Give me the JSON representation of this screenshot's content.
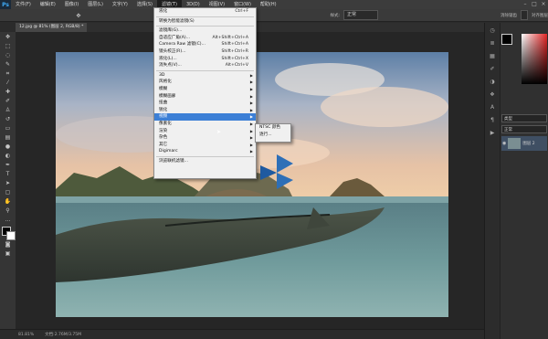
{
  "menubar": {
    "logo": "Ps",
    "items": [
      "文件(F)",
      "编辑(E)",
      "图像(I)",
      "图层(L)",
      "文字(Y)",
      "选择(S)",
      "滤镜(T)",
      "3D(D)",
      "视图(V)",
      "窗口(W)",
      "帮助(H)"
    ],
    "active_index": 6
  },
  "options": {
    "mode_label": "图层",
    "style_label": "样式:",
    "style_value": "正常",
    "smooth_label": "消除锯齿",
    "checkbox_label": "对齐图层"
  },
  "tab": {
    "title": "12.jpg @ 81% (图层 2, RGB/8) *"
  },
  "filter_menu": {
    "top": [
      {
        "label": "液化",
        "shortcut": "Ctrl+F"
      },
      {
        "label": "转换为智能滤镜(S)",
        "shortcut": ""
      }
    ],
    "mid": [
      {
        "label": "滤镜库(G)...",
        "shortcut": ""
      },
      {
        "label": "自适应广角(A)...",
        "shortcut": "Alt+Shift+Ctrl+A"
      },
      {
        "label": "Camera Raw 滤镜(C)...",
        "shortcut": "Shift+Ctrl+A"
      },
      {
        "label": "镜头校正(R)...",
        "shortcut": "Shift+Ctrl+R"
      },
      {
        "label": "液化(L)...",
        "shortcut": "Shift+Ctrl+X"
      },
      {
        "label": "消失点(V)...",
        "shortcut": "Alt+Ctrl+V"
      }
    ],
    "sub": [
      "3D",
      "风格化",
      "模糊",
      "模糊画廊",
      "扭曲",
      "锐化",
      "视频",
      "像素化",
      "渲染",
      "杂色",
      "其它"
    ],
    "plain": [
      "Digimarc"
    ],
    "browse": "浏览联机滤镜...",
    "highlight_label": "视频"
  },
  "video_submenu": [
    "NTSC 颜色",
    "逐行..."
  ],
  "statusbar": {
    "zoom": "81.81%",
    "doc": "文档:2.76M/3.75M"
  },
  "layers": {
    "layer_name": "图层 2",
    "kind_label": "类型",
    "blend": "正常"
  }
}
